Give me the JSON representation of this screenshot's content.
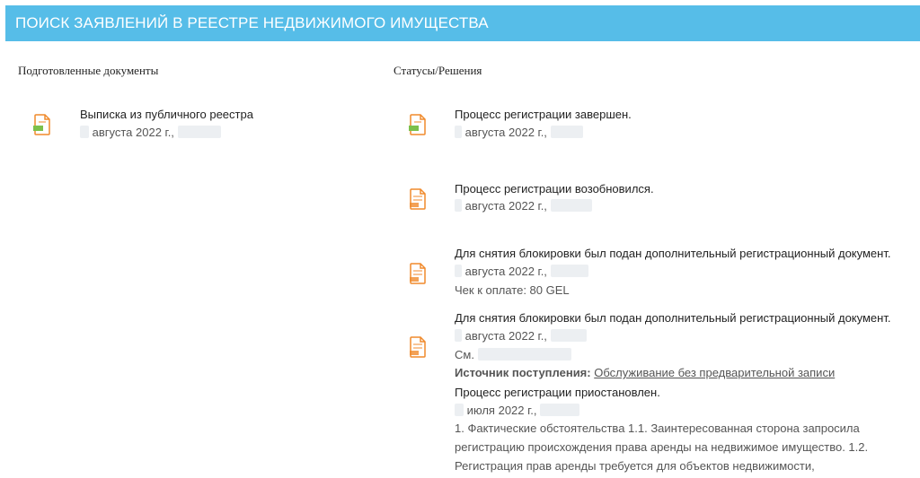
{
  "header": {
    "title": "ПОИСК ЗАЯВЛЕНИЙ В РЕЕСТРЕ НЕДВИЖИМОГО ИМУЩЕСТВА"
  },
  "columns": {
    "left_title": "Подготовленные документы",
    "right_title": "Статусы/Решения"
  },
  "prepared": [
    {
      "title": "Выписка из публичного реестра",
      "date": "августа 2022 г.,"
    }
  ],
  "statuses": [
    {
      "title": "Процесс регистрации завершен.",
      "date": "августа 2022 г., "
    },
    {
      "title": "Процесс регистрации возобновился.",
      "date": "августа 2022 г.,"
    },
    {
      "title": "Для снятия блокировки был подан дополнительный регистрационный документ.",
      "date": "августа 2022 г.,",
      "extra": "Чек к оплате: 80 GEL"
    },
    {
      "title": "Для снятия блокировки был подан дополнительный регистрационный документ.",
      "date": "августа 2022 г.,",
      "extra": "См."
    }
  ],
  "source": {
    "label": "Источник поступления:",
    "link": "Обслуживание без предварительной записи"
  },
  "suspended": {
    "title": "Процесс регистрации приостановлен.",
    "date": "июля 2022 г.,",
    "paragraph": "1. Фактические обстоятельства 1.1. Заинтересованная сторона запросила регистрацию происхождения права аренды на недвижимое имущество. 1.2. Регистрация прав аренды требуется для объектов недвижимости,"
  },
  "icons": {
    "document": "pdf-document-icon",
    "accent": "#f08a2c",
    "badge": "#7cc04b"
  }
}
